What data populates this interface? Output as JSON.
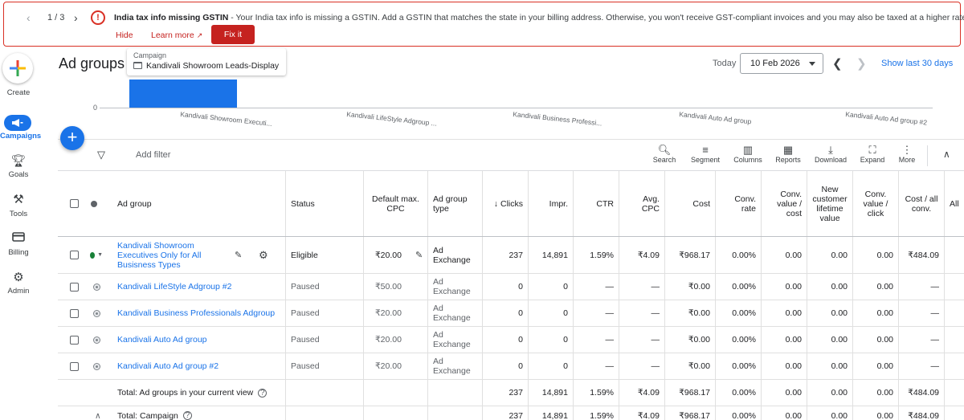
{
  "banner": {
    "counter": "1 / 3",
    "title": "India tax info missing GSTIN",
    "message": " - Your India tax info is missing a GSTIN. Add a GSTIN that matches the state in your billing address. Otherwise, you won't receive GST-compliant invoices and you may also be taxed at a higher rate.",
    "hide": "Hide",
    "learn_more": "Learn more",
    "fix_it": "Fix it"
  },
  "nav": {
    "create": "Create",
    "campaigns": "Campaigns",
    "goals": "Goals",
    "tools": "Tools",
    "billing": "Billing",
    "admin": "Admin"
  },
  "header": {
    "title": "Ad groups",
    "campaign_label": "Campaign",
    "campaign_name": "Kandivali Showroom Leads-Display",
    "today": "Today",
    "date": "10 Feb 2026",
    "show_last": "Show last 30 days"
  },
  "chart_data": {
    "type": "bar",
    "categories": [
      "Kandivali Showroom Executi...",
      "Kandivali LifeStyle Adgroup ...",
      "Kandivali Business Professi...",
      "Kandivali Auto Ad group",
      "Kandivali Auto Ad group #2"
    ],
    "values": [
      237,
      0,
      0,
      0,
      0
    ],
    "ytick": "0",
    "colors": {
      "bar": "#1a73e8"
    }
  },
  "toolbar": {
    "add_filter": "Add filter",
    "search": "Search",
    "segment": "Segment",
    "columns": "Columns",
    "reports": "Reports",
    "download": "Download",
    "expand": "Expand",
    "more": "More"
  },
  "table": {
    "headers": {
      "ad_group": "Ad group",
      "status": "Status",
      "cpc": "Default max. CPC",
      "type": "Ad group type",
      "clicks": "Clicks",
      "impr": "Impr.",
      "ctr": "CTR",
      "avg_cpc": "Avg. CPC",
      "cost": "Cost",
      "conv_rate": "Conv. rate",
      "conv_value_cost": "Conv. value / cost",
      "new_cust": "New customer lifetime value",
      "conv_value_click": "Conv. value / click",
      "cost_all_conv": "Cost / all conv.",
      "all": "All"
    },
    "rows": [
      {
        "name": "Kandivali Showroom Executives Only for All Busisness Types",
        "status": "Eligible",
        "cpc": "₹20.00",
        "type": "Ad Exchange",
        "clicks": "237",
        "impr": "14,891",
        "ctr": "1.59%",
        "avg_cpc": "₹4.09",
        "cost": "₹968.17",
        "conv_rate": "0.00%",
        "cvc": "0.00",
        "ncl": "0.00",
        "cvclick": "0.00",
        "cac": "₹484.09"
      },
      {
        "name": "Kandivali LifeStyle Adgroup #2",
        "status": "Paused",
        "cpc": "₹50.00",
        "type": "Ad Exchange",
        "clicks": "0",
        "impr": "0",
        "ctr": "—",
        "avg_cpc": "—",
        "cost": "₹0.00",
        "conv_rate": "0.00%",
        "cvc": "0.00",
        "ncl": "0.00",
        "cvclick": "0.00",
        "cac": "—"
      },
      {
        "name": "Kandivali Business Professionals Adgroup",
        "status": "Paused",
        "cpc": "₹20.00",
        "type": "Ad Exchange",
        "clicks": "0",
        "impr": "0",
        "ctr": "—",
        "avg_cpc": "—",
        "cost": "₹0.00",
        "conv_rate": "0.00%",
        "cvc": "0.00",
        "ncl": "0.00",
        "cvclick": "0.00",
        "cac": "—"
      },
      {
        "name": "Kandivali Auto Ad group",
        "status": "Paused",
        "cpc": "₹20.00",
        "type": "Ad Exchange",
        "clicks": "0",
        "impr": "0",
        "ctr": "—",
        "avg_cpc": "—",
        "cost": "₹0.00",
        "conv_rate": "0.00%",
        "cvc": "0.00",
        "ncl": "0.00",
        "cvclick": "0.00",
        "cac": "—"
      },
      {
        "name": "Kandivali Auto Ad group #2",
        "status": "Paused",
        "cpc": "₹20.00",
        "type": "Ad Exchange",
        "clicks": "0",
        "impr": "0",
        "ctr": "—",
        "avg_cpc": "—",
        "cost": "₹0.00",
        "conv_rate": "0.00%",
        "cvc": "0.00",
        "ncl": "0.00",
        "cvclick": "0.00",
        "cac": "—"
      }
    ],
    "total_view": {
      "label": "Total: Ad groups in your current view",
      "clicks": "237",
      "impr": "14,891",
      "ctr": "1.59%",
      "avg_cpc": "₹4.09",
      "cost": "₹968.17",
      "conv_rate": "0.00%",
      "cvc": "0.00",
      "ncl": "0.00",
      "cvclick": "0.00",
      "cac": "₹484.09"
    },
    "total_campaign": {
      "label": "Total: Campaign",
      "clicks": "237",
      "impr": "14,891",
      "ctr": "1.59%",
      "avg_cpc": "₹4.09",
      "cost": "₹968.17",
      "conv_rate": "0.00%",
      "cvc": "0.00",
      "ncl": "0.00",
      "cvclick": "0.00",
      "cac": "₹484.09"
    }
  }
}
